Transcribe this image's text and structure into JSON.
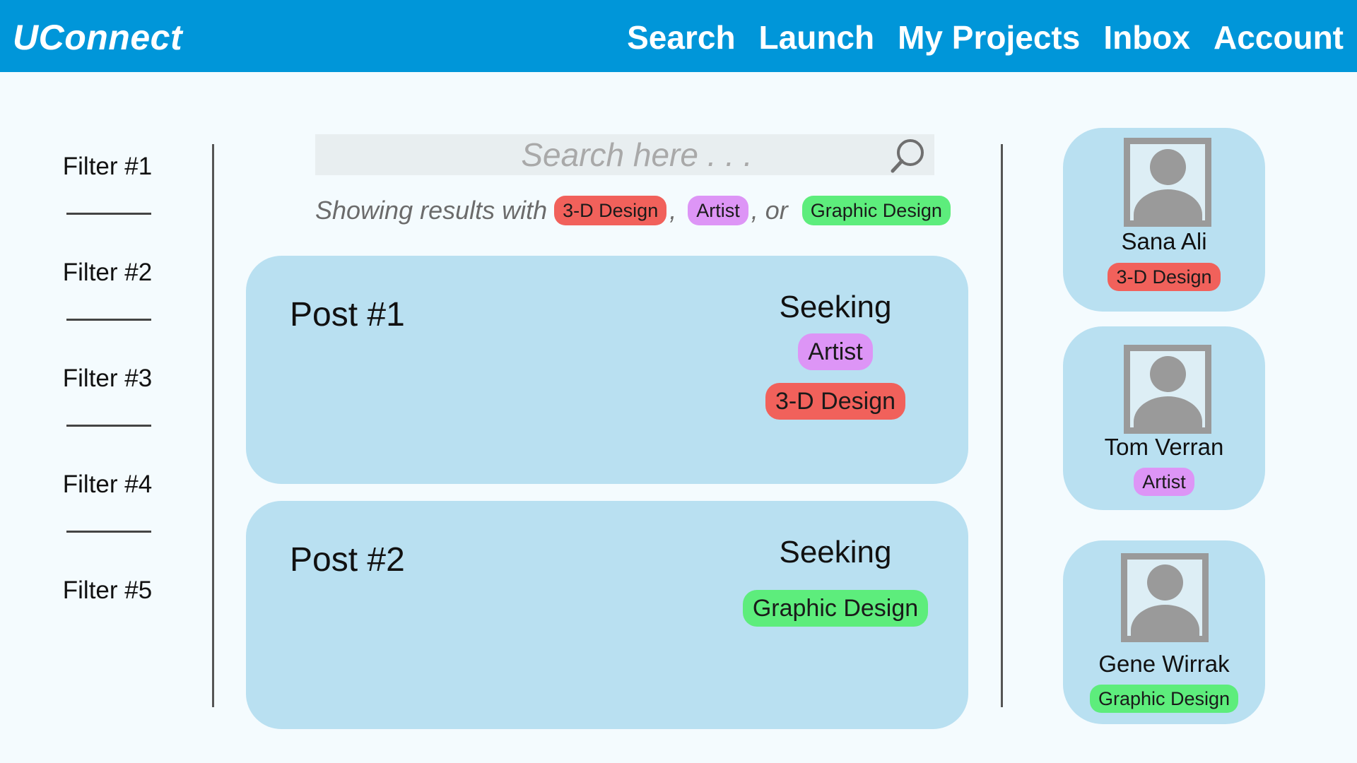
{
  "app": {
    "title": "UConnect"
  },
  "nav": [
    "Search",
    "Launch",
    "My Projects",
    "Inbox",
    "Account"
  ],
  "filters": [
    "Filter  #1",
    "Filter #2",
    "Filter #3",
    "Filter #4",
    "Filter #5"
  ],
  "search": {
    "placeholder": "Search here . . ."
  },
  "results": {
    "prefix": "Showing results with",
    "tags": [
      "3-D Design",
      "Artist",
      "Graphic Design"
    ],
    "separators": [
      ",",
      ", or"
    ]
  },
  "posts": [
    {
      "title": "Post #1",
      "seeking_label": "Seeking",
      "tags": [
        "Artist",
        "3-D Design"
      ]
    },
    {
      "title": "Post #2",
      "seeking_label": "Seeking",
      "tags": [
        "Graphic Design"
      ]
    }
  ],
  "profiles": [
    {
      "name": "Sana Ali",
      "tag": "3-D Design"
    },
    {
      "name": "Tom Verran",
      "tag": "Artist"
    },
    {
      "name": "Gene Wirrak",
      "tag": "Graphic Design"
    }
  ],
  "tag_colors": {
    "3-D Design": "#f1615b",
    "Artist": "#dd95f6",
    "Graphic Design": "#5ded7c"
  },
  "colors": {
    "header": "#0096d9",
    "card": "#b9e0f1",
    "background": "#f4fbfe"
  }
}
